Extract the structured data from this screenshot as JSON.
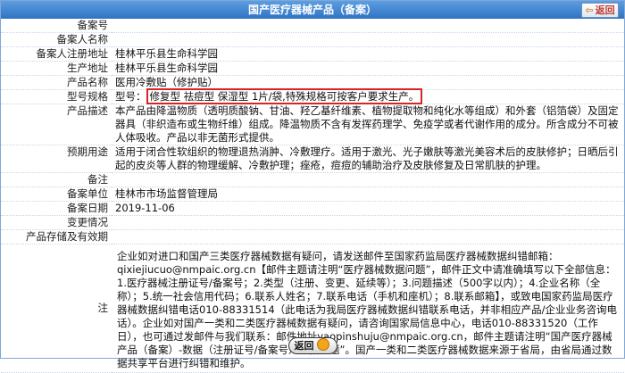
{
  "header": {
    "title": "国产医疗器械产品（备案）",
    "back_label": "返回"
  },
  "fields": {
    "reg_no": {
      "label": "备案号",
      "value": ""
    },
    "filer": {
      "label": "备案人名称",
      "value": ""
    },
    "reg_address": {
      "label": "备案人注册地址",
      "value": "桂林平乐县生命科学园"
    },
    "prod_address": {
      "label": "生产地址",
      "value": "桂林平乐县生命科学园"
    },
    "product_name": {
      "label": "产品名称",
      "value": "医用冷敷贴（修护贴）"
    },
    "model": {
      "label": "型号规格",
      "prefix": "型号：",
      "value": "修复型 祛痘型 保湿型 1片/袋,特殊规格可按客户要求生产。"
    },
    "description": {
      "label": "产品描述",
      "value": "本产品由降温物质（透明质酸钠、甘油、羟乙基纤维素、植物提取物和纯化水等组成）和外套（铝箔袋）及固定器具（非织造布或生物纤维）组成。降温物质不含有发挥药理学、免疫学或者代谢作用的成分。所含成分不可被人体吸收。产品以非无菌形式提供。"
    },
    "intended_use": {
      "label": "预期用途",
      "value": "适用于闭合性软组织的物理退热消肿、冷敷理疗。适用于激光、光子嫩肤等激光美容术后的皮肤修护；日晒后引起的皮炎等人群的物理缓解、冷敷护理；痤疮，痘痘的辅助治疗及皮肤修复及日常肌肤的护理。"
    },
    "remark": {
      "label": "备注",
      "value": ""
    },
    "authority": {
      "label": "备案单位",
      "value": "桂林市市场监督管理局"
    },
    "date": {
      "label": "备案日期",
      "value": "2019-11-06"
    },
    "changes": {
      "label": "变更情况",
      "value": ""
    },
    "storage": {
      "label": "产品存储及有效期",
      "value": ""
    }
  },
  "notes": {
    "label": "注",
    "text": "企业如对进口和国产三类医疗器械数据有疑问，请发送邮件至国家药监局医疗器械数据纠错邮箱：qixiejiucuo@nmpaic.org.cn【邮件主题请注明“医疗器械数据问题”，邮件正文中请准确填写以下全部信息：1.医疗器械注册证号/备案号；2.类型（注册、变更、延续等）；3.问题描述（500字以内）；4.企业名称（全称）；5.统一社会信用代码；6.联系人姓名；7.联系电话（手机和座机）；8.联系邮箱】，或致电国家药监局医疗器械数据纠错电话010-88331514（此电话为我局医疗器械数据纠错联系电话，并非相应产品/企业业务咨询电话）。企业如对国产一类和二类医疗器械数据有疑问，请咨询国家局信息中心，电话010-88331520（工作日），也可通过发邮件与我们联系：邮件地址yaopinshuju@nmpaic.org.cn，邮件主题请注明“国产医疗器械产品（备案）-数据（注册证号/备案号）数据问题”。国产一类和二类医疗器械数据来源于省局，由省局通过数据共享平台进行纠错和维护。"
  },
  "footer": {
    "back_label": "返回"
  }
}
